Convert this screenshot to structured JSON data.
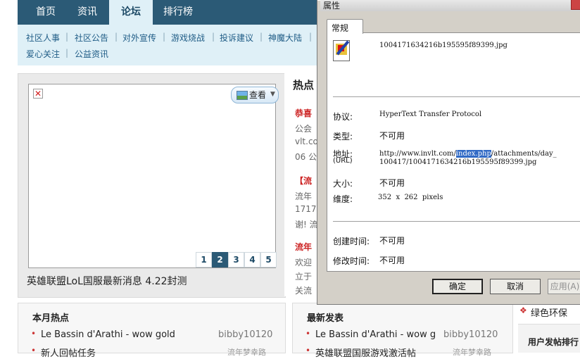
{
  "nav": {
    "tabs": [
      "首页",
      "资讯",
      "论坛",
      "排行榜"
    ],
    "active": 2
  },
  "subnav": {
    "row1": [
      "社区人事",
      "社区公告",
      "对外宣传",
      "游戏烧战",
      "投诉建议",
      "神魔大陆"
    ],
    "row2": [
      "爱心关注",
      "公益资讯"
    ],
    "separator": "|"
  },
  "feature": {
    "view_button": "查看",
    "pages": [
      "1",
      "2",
      "3",
      "4",
      "5"
    ],
    "active_page": 1,
    "caption": "英雄联盟LoL国服最新消息 4.22封测"
  },
  "hot": {
    "title": "热点",
    "items": [
      {
        "head": "恭喜",
        "lines": [
          "公会",
          "vlt.co",
          "06 公"
        ]
      },
      {
        "head": "【流",
        "lines": [
          "流年",
          "1717",
          "谢! 流"
        ]
      },
      {
        "head": "流年",
        "lines": [
          "欢迎",
          "立于",
          "关流"
        ]
      }
    ]
  },
  "monthly_hot": {
    "title": "本月热点",
    "items": [
      {
        "title": "Le Bassin d'Arathi - wow gold",
        "author": "bibby10120"
      },
      {
        "title": "新人回帖任务",
        "author": "流年梦幸路"
      }
    ]
  },
  "latest": {
    "title": "最新发表",
    "items": [
      {
        "title": "Le Bassin d'Arathi - wow g",
        "author": "bibby10120"
      },
      {
        "title": "英雄联盟国服游戏激活帖",
        "author": "流年梦幸路"
      }
    ]
  },
  "side": {
    "green": "绿色环保",
    "ranking": "用户发帖排行"
  },
  "dialog": {
    "title": "属性",
    "tab": "常规",
    "filename": "1004171634216b195595f89399.jpg",
    "labels": {
      "protocol": "协议:",
      "type": "类型:",
      "address": "地址:",
      "address_sub": "(URL)",
      "size": "大小:",
      "dimensions": "维度:",
      "created": "创建时间:",
      "modified": "修改时间:"
    },
    "values": {
      "protocol": "HyperText Transfer Protocol",
      "type": "不可用",
      "url_pre": "http://www.invlt.com/",
      "url_sel": "index.php",
      "url_post": "/attachments/day_",
      "url_line2": "100417/1004171634216b195595f89399.jpg",
      "size": "不可用",
      "dimensions": "352  x  262  pixels",
      "created": "不可用",
      "modified": "不可用"
    },
    "buttons": {
      "ok": "确定",
      "cancel": "取消",
      "apply": "应用(A)"
    }
  }
}
